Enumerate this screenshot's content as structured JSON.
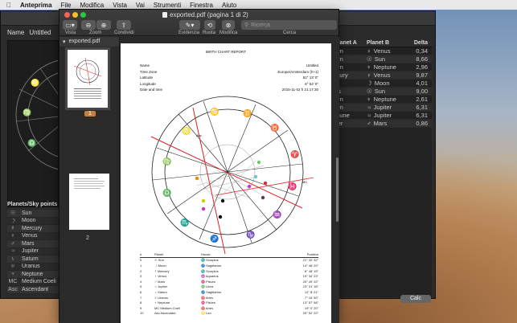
{
  "menubar": {
    "app": "Anteprima",
    "items": [
      "File",
      "Modifica",
      "Vista",
      "Vai",
      "Strumenti",
      "Finestra",
      "Aiuto"
    ]
  },
  "bgwin": {
    "name_label": "Name",
    "name_value": "Untitled",
    "planets_header": "Planets/Sky points",
    "planets": [
      {
        "glyph": "☉",
        "name": "Sun"
      },
      {
        "glyph": "☽",
        "name": "Moon"
      },
      {
        "glyph": "☿",
        "name": "Mercury"
      },
      {
        "glyph": "♀",
        "name": "Venus"
      },
      {
        "glyph": "♂",
        "name": "Mars"
      },
      {
        "glyph": "♃",
        "name": "Jupiter"
      },
      {
        "glyph": "♄",
        "name": "Saturn"
      },
      {
        "glyph": "♅",
        "name": "Uranus"
      },
      {
        "glyph": "♆",
        "name": "Neptune"
      },
      {
        "glyph": "MC",
        "name": "Medium Coeli"
      },
      {
        "glyph": "Asc",
        "name": "Ascendant"
      }
    ],
    "aspects_headers": [
      "Planet A",
      "Planet B",
      "Delta"
    ],
    "aspects": [
      {
        "a": "urn",
        "glyph": "♀",
        "b": "Venus",
        "delta": "0,34"
      },
      {
        "a": "urn",
        "glyph": "☉",
        "b": "Sun",
        "delta": "8,66"
      },
      {
        "a": "urn",
        "glyph": "♆",
        "b": "Neptune",
        "delta": "2,96"
      },
      {
        "a": "rcury",
        "glyph": "♀",
        "b": "Venus",
        "delta": "9,87"
      },
      {
        "a": "rs",
        "glyph": "☽",
        "b": "Moon",
        "delta": "4,01"
      },
      {
        "a": "us",
        "glyph": "☉",
        "b": "Sun",
        "delta": "9,00"
      },
      {
        "a": "urn",
        "glyph": "♆",
        "b": "Neptune",
        "delta": "2,61"
      },
      {
        "a": "urn",
        "glyph": "♃",
        "b": "Jupiter",
        "delta": "6,31"
      },
      {
        "a": "ptune",
        "glyph": "♃",
        "b": "Jupiter",
        "delta": "6,31"
      },
      {
        "a": "iter",
        "glyph": "♂",
        "b": "Mars",
        "delta": "0,86"
      }
    ],
    "calc_label": "Calc"
  },
  "preview": {
    "title": "exported.pdf (pagina 1 di 2)",
    "toolbar": {
      "vista": "Vista",
      "zoom": "Zoom",
      "condividi": "Condividi",
      "evidenzia": "Evidenzia",
      "ruota": "Ruota",
      "modifica": "Modifica",
      "cerca": "Cerca",
      "search_placeholder": "Ricerca"
    },
    "sidebar": {
      "file": "exported.pdf",
      "page1": "1",
      "page2": "2"
    },
    "page": {
      "report_title": "BIRTH CHART REPORT",
      "info": [
        {
          "k": "Name",
          "v": "Untitled"
        },
        {
          "k": "Time Zone",
          "v": "Europe/Amsterdam (h+1)"
        },
        {
          "k": "Latitude",
          "v": "52° 13' 0\""
        },
        {
          "k": "Longitude",
          "v": "6° 54' 0\""
        },
        {
          "k": "Date and time",
          "v": "2016-11-02 h 21:17:30"
        }
      ],
      "table_headers": [
        "#",
        "Planet",
        "House",
        "Position"
      ],
      "rows": [
        {
          "n": "0",
          "planet": "☉ Sun",
          "house": "♏ Scorpius",
          "pos": "21° 32' 32\""
        },
        {
          "n": "1",
          "planet": "☽ Moon",
          "house": "♐ Sagittarius",
          "pos": "14° 48' 20\""
        },
        {
          "n": "2",
          "planet": "☿ Mercury",
          "house": "♏ Scorpius",
          "pos": "6° 48' 15\""
        },
        {
          "n": "3",
          "planet": "♀ Venus",
          "house": "♒ Aquarius",
          "pos": "19° 34' 23\""
        },
        {
          "n": "4",
          "planet": "♂ Mars",
          "house": "♓ Pisces",
          "pos": "20° 49' 22\""
        },
        {
          "n": "5",
          "planet": "♃ Jupiter",
          "house": "♎ Libra",
          "pos": "23° 31' 18\""
        },
        {
          "n": "6",
          "planet": "♄ Saturn",
          "house": "♐ Sagittarius",
          "pos": "12° 8' 21\""
        },
        {
          "n": "7",
          "planet": "♅ Uranus",
          "house": "♈ Aries",
          "pos": "7° 16' 50\""
        },
        {
          "n": "8",
          "planet": "♆ Neptune",
          "house": "♓ Pisces",
          "pos": "13° 57' 58\""
        },
        {
          "n": "9",
          "planet": "MC Medium Coeli",
          "house": "♈ Aries",
          "pos": "19° 0' 20\""
        },
        {
          "n": "10",
          "planet": "Asc Ascendant",
          "house": "♌ Leo",
          "pos": "25° 52' 20\""
        }
      ],
      "chart_labels": {
        "asc": "Asc",
        "mc": "MC",
        "zodiac": [
          "♋",
          "♊",
          "♉",
          "♈",
          "♓",
          "♒",
          "♑",
          "♐",
          "♏",
          "♎",
          "♍",
          "♌"
        ]
      }
    }
  }
}
